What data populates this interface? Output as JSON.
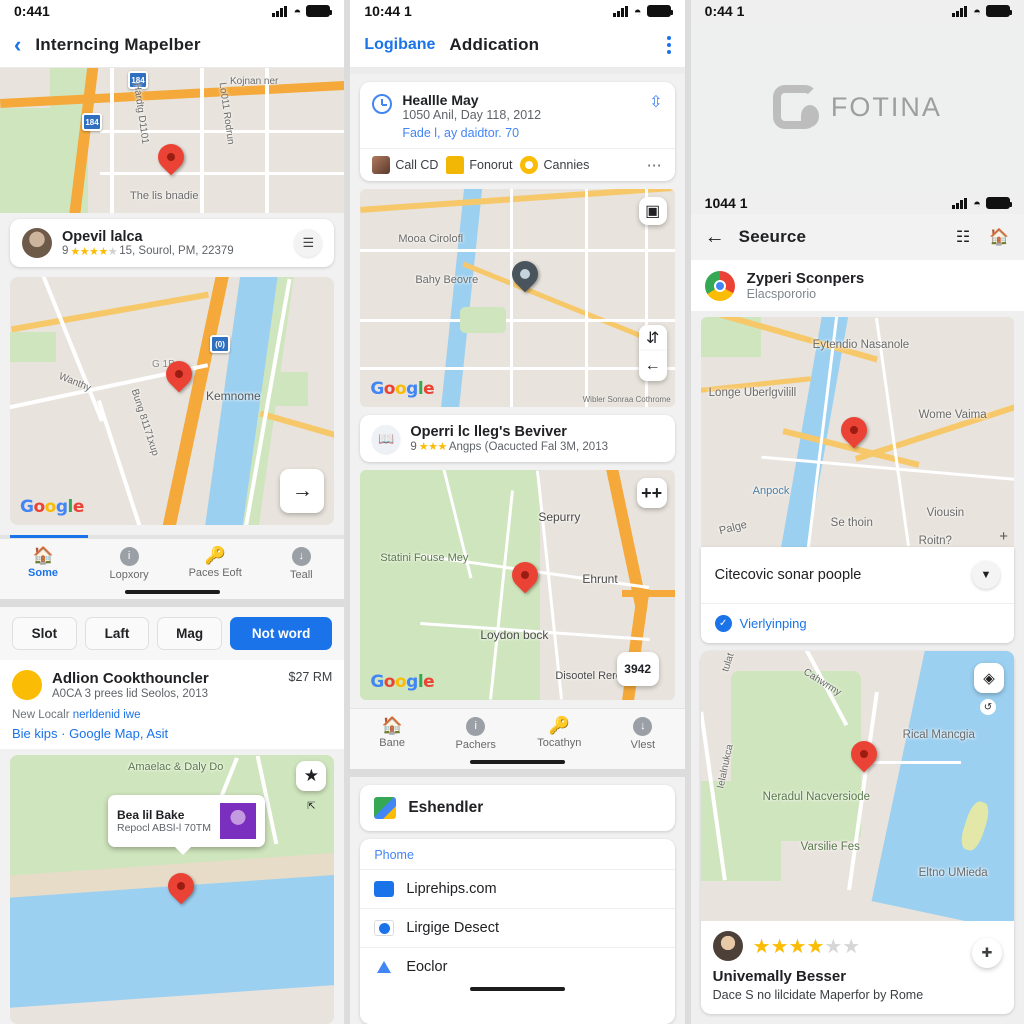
{
  "left": {
    "status": {
      "time": "0:441",
      "signal_icon": "signal-bars-icon",
      "wifi_icon": "wifi-icon",
      "battery_icon": "battery-icon"
    },
    "appbar": {
      "back_icon": "chevron-left-icon",
      "title": "Interncing Mapelber"
    },
    "map1": {
      "labels": [
        "The lis bnadie",
        "Kojnan ner",
        "Hardtg D1101",
        "Lo011 Rodrun"
      ],
      "shield": "184",
      "pin_icon": "map-pin-icon",
      "logo": "Google"
    },
    "place1": {
      "title": "Opevil lalca",
      "rating_count": "9",
      "stars": 4,
      "stars_total": 5,
      "meta": "15, Sourol, PM, 22379",
      "action_icon": "layers-icon",
      "avatar": "user-avatar"
    },
    "map2": {
      "labels": [
        "Kemnome",
        "Wanthy",
        "G 1B",
        "Bung 81171xup"
      ],
      "shield": "(0)",
      "pin_icon": "map-pin-icon",
      "logo": "Google",
      "fab_icon": "arrow-right-icon"
    },
    "progress_label": "scroll-progress",
    "nav": [
      {
        "label": "Some",
        "icon": "home-icon",
        "active": true
      },
      {
        "label": "Lopxory",
        "icon": "info-circle-icon",
        "active": false
      },
      {
        "label": "Paces Eoft",
        "icon": "key-icon",
        "active": false
      },
      {
        "label": "Teall",
        "icon": "download-circle-icon",
        "active": false
      }
    ],
    "chips": [
      {
        "label": "Slot",
        "primary": false
      },
      {
        "label": "Laft",
        "primary": false
      },
      {
        "label": "Mag",
        "primary": false
      },
      {
        "label": "Not word",
        "primary": true
      }
    ],
    "listing": {
      "title": "Adlion Cookthouncler",
      "price": "$27 RM",
      "subtitle": "A0CA 3 prees lid Seolos, 2013",
      "note_grey": "New Localr",
      "note_blue": "nerldenid iwe",
      "links": "Bie kips · Google Map, Asit",
      "avatar": "user-avatar-yellow"
    },
    "map3": {
      "labels": [
        "Amaelac & Daly Do"
      ],
      "callout": {
        "title": "Bea lil Bake",
        "sub": "Repocl ABSl-l 70TM",
        "thumb": "photo-thumbnail"
      },
      "star_btn_icon": "star-icon",
      "small_btn_icon": "share-icon",
      "pin_icon": "map-pin-icon"
    }
  },
  "mid": {
    "status": {
      "time": "10:44 1",
      "signal_icon": "signal-bars-icon",
      "wifi_icon": "wifi-icon",
      "battery_icon": "battery-icon"
    },
    "appbar": {
      "link": "Logibane",
      "title": "Addication",
      "menu_icon": "kebab-menu-icon"
    },
    "notification": {
      "icon": "clock-icon",
      "title": "Heallle May",
      "subtitle": "1050 Anil, Day 118, 2012",
      "link": "Fade l, ay daidtor. 70",
      "right_icon": "share-nodes-icon",
      "actions": [
        {
          "label": "Call CD",
          "icon": "photo-icon"
        },
        {
          "label": "Fonorut",
          "icon": "folder-icon"
        },
        {
          "label": "Cannies",
          "icon": "dot-icon"
        }
      ],
      "more_icon": "more-horizontal-icon"
    },
    "map1": {
      "labels": [
        "Mooa Cirolofl",
        "Bahy Beovre"
      ],
      "attrib": "Wibler Sonraa Cothrome",
      "logo": "Google",
      "pin_icon": "map-pin-grey-icon",
      "buttons": [
        "qr-icon",
        "transit-icon",
        "arrow-left-icon"
      ]
    },
    "place1": {
      "title": "Operri lc lleg's Beviver",
      "rating_count": "9",
      "stars": 3,
      "stars_total": 3,
      "meta": "Angps (Oacucted Fal 3M, 2013",
      "icon": "book-icon"
    },
    "map2": {
      "labels": [
        "Sepurry",
        "Statini Fouse Mey",
        "Ehrunt",
        "Loydon bock",
        "Disootel Rerd"
      ],
      "logo": "Google",
      "pin_icon": "map-pin-icon",
      "button_icon": "plus-icon",
      "tooltip": "3942"
    },
    "nav": [
      {
        "label": "Bane",
        "icon": "home-icon",
        "active": false
      },
      {
        "label": "Pachers",
        "icon": "info-circle-icon",
        "active": false
      },
      {
        "label": "Tocathyn",
        "icon": "key-icon",
        "active": false
      },
      {
        "label": "Vlest",
        "icon": "download-circle-icon",
        "active": false
      }
    ],
    "simple_card": {
      "label": "Eshendler",
      "icon": "google-maps-icon"
    },
    "list": {
      "header": "Phome",
      "rows": [
        {
          "label": "Liprehips.com",
          "icon": "blue-square-icon"
        },
        {
          "label": "Lirgige Desect",
          "icon": "blue-circle-icon"
        },
        {
          "label": "Eoclor",
          "icon": "triangle-icon"
        }
      ]
    }
  },
  "right": {
    "status": {
      "time": "0:44 1",
      "signal_icon": "signal-bars-icon",
      "wifi_icon": "wifi-icon",
      "battery_icon": "battery-icon"
    },
    "splash": {
      "logo_icon": "fotina-logo-icon",
      "wordmark": "FOTINA"
    },
    "inner_status": {
      "time": "1044 1",
      "signal_icon": "signal-bars-icon",
      "wifi_icon": "wifi-icon",
      "battery_icon": "battery-icon"
    },
    "appbar": {
      "back_icon": "arrow-left-icon",
      "title": "Seeurce",
      "icon1": "info-box-icon",
      "icon2": "home-shield-icon"
    },
    "account": {
      "title": "Zyperi Sconpers",
      "subtitle": "Elacspororio",
      "avatar": "chrome-icon"
    },
    "map1": {
      "labels": [
        "Eytendio Nasanole",
        "Longe Uberlgvilill",
        "Wome Vaima",
        "Anpock",
        "Se thoin",
        "Viousin",
        "Roitn?",
        "Palge"
      ],
      "pin_icon": "map-pin-icon",
      "plus_icon": "plus-icon"
    },
    "panel_card": {
      "title": "Citecovic sonar poople",
      "chevron_icon": "chevron-down-icon",
      "link": "Vierlyinping",
      "link_icon": "check-circle-icon"
    },
    "map2": {
      "labels": [
        "Cahwrmy",
        "Rical Mancgia",
        "Neradul Nacversiode",
        "Varsilie Fes",
        "Eltno UMieda",
        "tulat",
        "Ielalnukca"
      ],
      "pin_icon": "map-pin-icon",
      "buttons": [
        "compass-icon",
        "rotate-icon"
      ]
    },
    "review": {
      "stars": 4,
      "stars_total": 6,
      "title": "Univemally Besser",
      "subtitle": "Dace S no lilcidate Maperfor by Rome",
      "avatar": "user-avatar",
      "fab_icon": "directions-icon"
    }
  },
  "colors": {
    "accent": "#1a73e8",
    "pin": "#ea4335",
    "star": "#fbbc05",
    "bg": "#dcdcdc",
    "panel_bg": "#f1f1f1"
  }
}
